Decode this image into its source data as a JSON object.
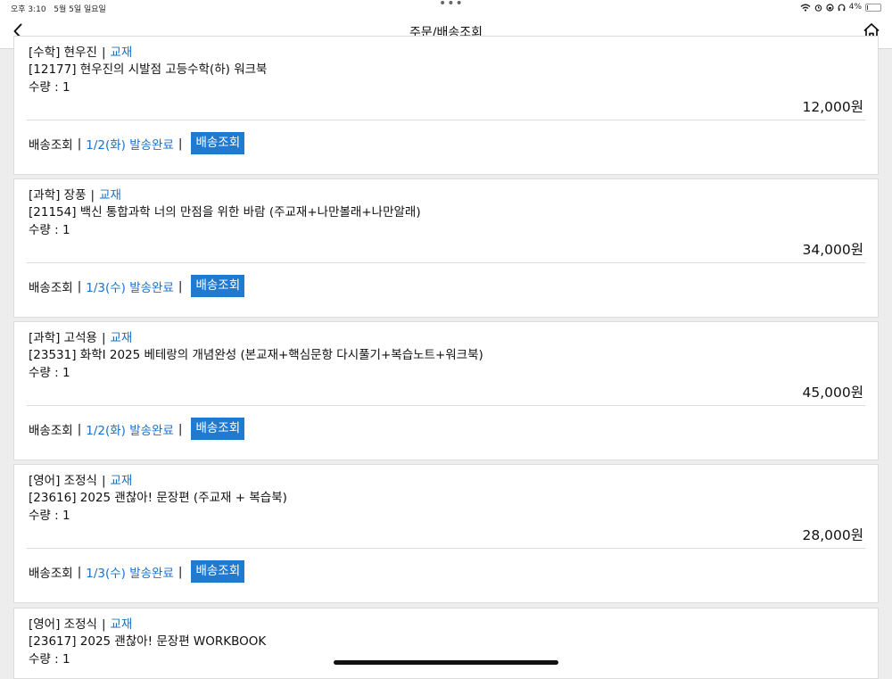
{
  "status": {
    "time": "오후 3:10",
    "date": "5월 5일 일요일",
    "dots": "•••",
    "battery": "4%"
  },
  "header": {
    "title": "주문/배송조회"
  },
  "orders": [
    {
      "subject": "[수학] 현우진",
      "category": "교재",
      "name": "[12177] 현우진의 시발점 고등수학(하) 워크북",
      "qty": "수량 : 1",
      "price": "12,000원",
      "ship_label": "배송조회",
      "ship_status": "1/2(화) 발송완료",
      "ship_button": "배송조회"
    },
    {
      "subject": "[과학] 장풍",
      "category": "교재",
      "name": "[21154] 백신 통합과학 너의 만점을 위한 바람 (주교재+나만볼래+나만알래)",
      "qty": "수량 : 1",
      "price": "34,000원",
      "ship_label": "배송조회",
      "ship_status": "1/3(수) 발송완료",
      "ship_button": "배송조회"
    },
    {
      "subject": "[과학] 고석용",
      "category": "교재",
      "name": "[23531] 화학I 2025 베테랑의 개념완성 (본교재+핵심문항 다시풀기+복습노트+워크북)",
      "qty": "수량 : 1",
      "price": "45,000원",
      "ship_label": "배송조회",
      "ship_status": "1/2(화) 발송완료",
      "ship_button": "배송조회"
    },
    {
      "subject": "[영어] 조정식",
      "category": "교재",
      "name": "[23616] 2025 괜찮아! 문장편 (주교재 + 복습북)",
      "qty": "수량 : 1",
      "price": "28,000원",
      "ship_label": "배송조회",
      "ship_status": "1/3(수) 발송완료",
      "ship_button": "배송조회"
    },
    {
      "subject": "[영어] 조정식",
      "category": "교재",
      "name": "[23617] 2025 괜찮아! 문장편 WORKBOOK",
      "qty": "수량 : 1",
      "price": "",
      "ship_label": "",
      "ship_status": "",
      "ship_button": ""
    }
  ],
  "icons": {
    "back": "chevron-left-icon",
    "home": "home-icon"
  },
  "colors": {
    "accent": "#1f7ad0",
    "link": "#1a72c9"
  }
}
